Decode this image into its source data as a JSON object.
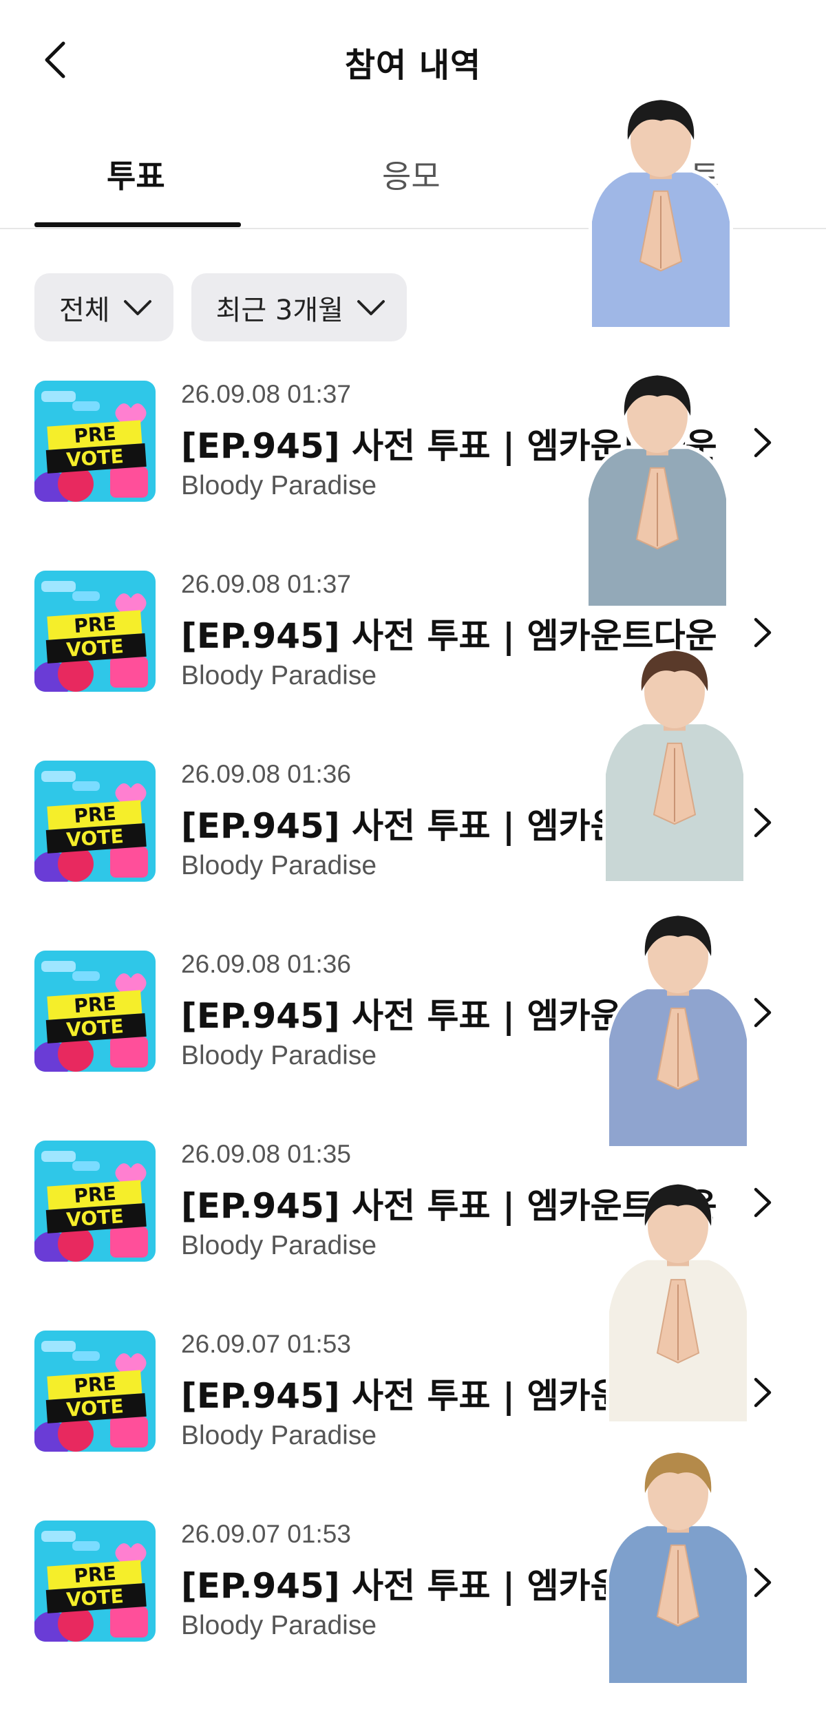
{
  "header": {
    "title": "참여 내역"
  },
  "tabs": [
    {
      "label": "투표",
      "active": true
    },
    {
      "label": "응모",
      "active": false
    },
    {
      "label": "포트",
      "active": false
    }
  ],
  "filters": [
    {
      "label": "전체"
    },
    {
      "label": "최근 3개월"
    }
  ],
  "thumbnail": {
    "line1": "PRE",
    "line2": "VOTE"
  },
  "items": [
    {
      "date": "26.09.08 01:37",
      "title": "[EP.945] 사전 투표 | 엠카운트다운",
      "subtitle": "Bloody Paradise"
    },
    {
      "date": "26.09.08 01:37",
      "title": "[EP.945] 사전 투표 | 엠카운트다운",
      "subtitle": "Bloody Paradise"
    },
    {
      "date": "26.09.08 01:36",
      "title": "[EP.945] 사전 투표 | 엠카운트다운",
      "subtitle": "Bloody Paradise"
    },
    {
      "date": "26.09.08 01:36",
      "title": "[EP.945] 사전 투표 | 엠카운트다운",
      "subtitle": "Bloody Paradise"
    },
    {
      "date": "26.09.08 01:35",
      "title": "[EP.945] 사전 투표 | 엠카운트다운",
      "subtitle": "Bloody Paradise"
    },
    {
      "date": "26.09.07 01:53",
      "title": "[EP.945] 사전 투표 | 엠카운트다운",
      "subtitle": "Bloody Paradise"
    },
    {
      "date": "26.09.07 01:53",
      "title": "[EP.945] 사전 투표 | 엠카운트다운",
      "subtitle": "Bloody Paradise"
    }
  ],
  "colors": {
    "thumb_bg": "#2fc7e8",
    "thumb_banner": "#111111",
    "thumb_yellow": "#f5ee2a",
    "thumb_pink": "#ff4f9a",
    "sticker_outline": "#ffffff"
  }
}
